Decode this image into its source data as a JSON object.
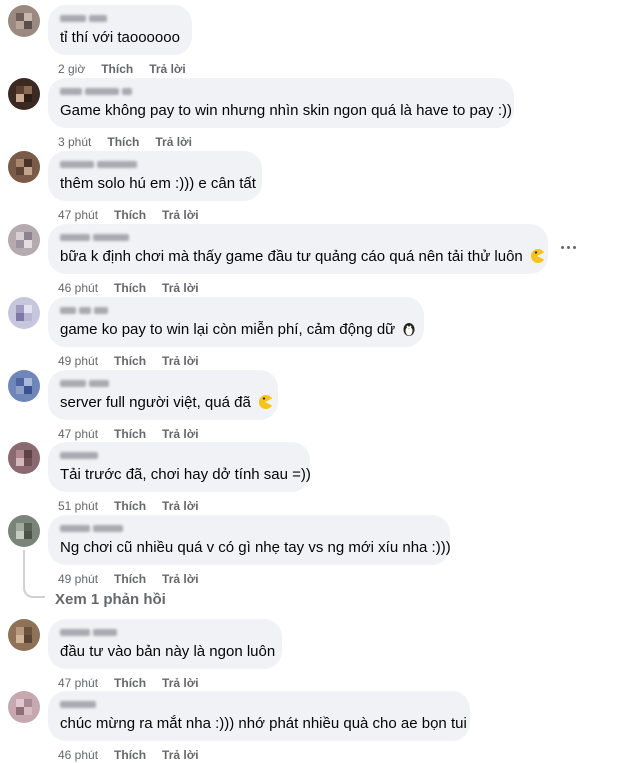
{
  "comments": [
    {
      "text": "tỉ thí với taoooooo",
      "time": "2 giờ",
      "like": "Thích",
      "reply": "Trả lời",
      "emoji": ""
    },
    {
      "text": "Game không pay to win nhưng nhìn skin ngon quá là have to pay :))",
      "time": "3 phút",
      "like": "Thích",
      "reply": "Trả lời",
      "emoji": ""
    },
    {
      "text": "thêm solo hú em :))) e cân tất",
      "time": "47 phút",
      "like": "Thích",
      "reply": "Trả lời",
      "emoji": ""
    },
    {
      "text": "bữa k định chơi mà thấy game đầu tư quảng cáo quá nên tải thử luôn",
      "time": "46 phút",
      "like": "Thích",
      "reply": "Trả lời",
      "emoji": "pacman"
    },
    {
      "text": "game ko pay to win lại còn miễn phí, cảm động dữ",
      "time": "49 phút",
      "like": "Thích",
      "reply": "Trả lời",
      "emoji": "penguin"
    },
    {
      "text": "server full người việt, quá đã",
      "time": "47 phút",
      "like": "Thích",
      "reply": "Trả lời",
      "emoji": "pacman"
    },
    {
      "text": "Tải trước đã, chơi hay dở tính sau =))",
      "time": "51 phút",
      "like": "Thích",
      "reply": "Trả lời",
      "emoji": ""
    },
    {
      "text": "Ng chơi cũ nhiều quá v có gì nhẹ tay vs ng mới xíu nha :)))",
      "time": "49 phút",
      "like": "Thích",
      "reply": "Trả lời",
      "emoji": ""
    },
    {
      "text": "đầu tư vào bản này là ngon luôn",
      "time": "47 phút",
      "like": "Thích",
      "reply": "Trả lời",
      "emoji": ""
    },
    {
      "text": "chúc mừng ra mắt nha :))) nhớ phát nhiều quà cho ae bọn tui",
      "time": "46 phút",
      "like": "Thích",
      "reply": "Trả lời",
      "emoji": ""
    }
  ],
  "view_replies": "Xem 1 phản hồi",
  "colors": {
    "bubble": "#f0f2f5",
    "meta": "#65676b",
    "text": "#050505"
  },
  "icons": {
    "more": "more-options-icon",
    "pacman": "pacman-emoji-icon",
    "penguin": "penguin-emoji-icon"
  }
}
